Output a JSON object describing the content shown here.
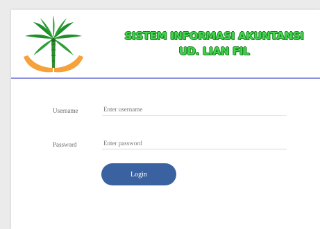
{
  "header": {
    "title_line1": "SISTEM INFORMASI AKUNTANSI",
    "title_line2": "UD. LIAN FIL",
    "logo_icon": "palm-tree-hands-logo",
    "colors": {
      "title_fill": "#3fd64a",
      "title_outline": "#1d7a26",
      "divider": "#8d8fe0"
    }
  },
  "form": {
    "username_label": "Username",
    "username_placeholder": "Enter username",
    "username_value": "",
    "password_label": "Password",
    "password_placeholder": "Enter password",
    "password_value": "",
    "login_label": "Login",
    "colors": {
      "button": "#3a62a0"
    }
  }
}
